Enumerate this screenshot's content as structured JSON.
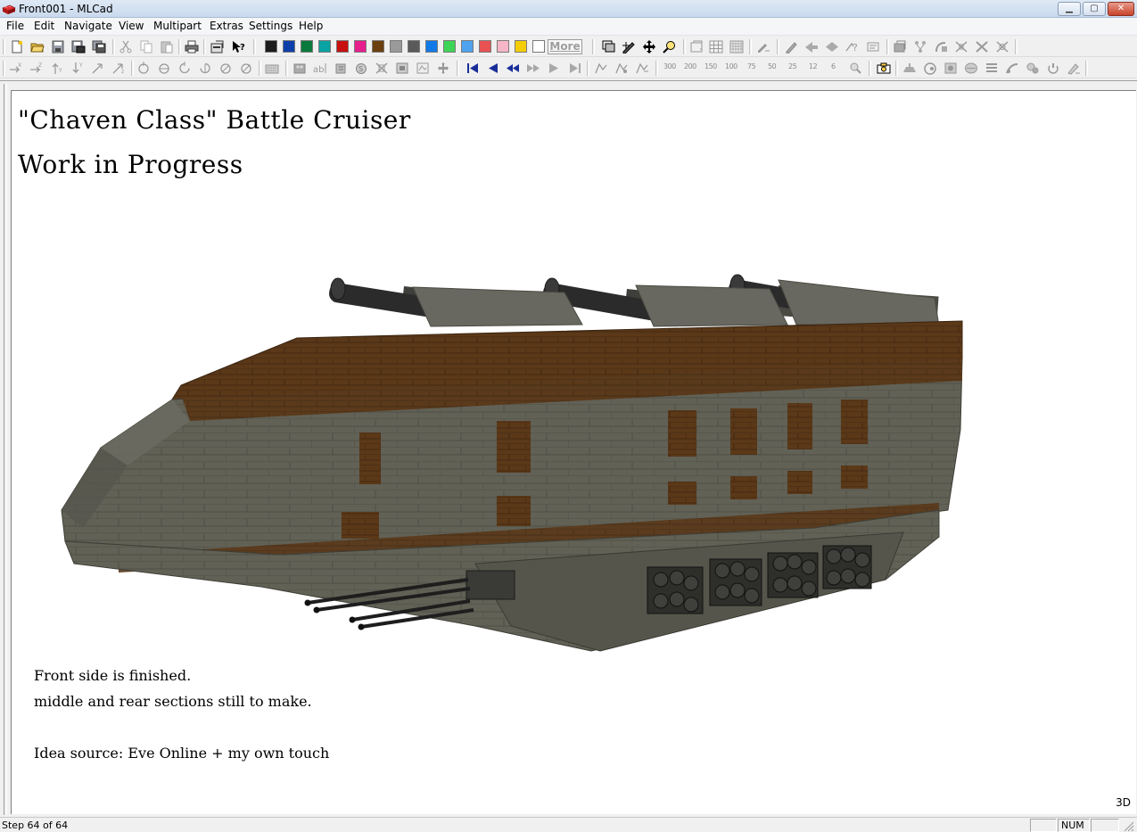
{
  "window": {
    "title": "Front001 - MLCad"
  },
  "menubar": {
    "items": [
      "File",
      "Edit",
      "Navigate",
      "View",
      "Multipart",
      "Extras",
      "Settings",
      "Help"
    ]
  },
  "toolbar": {
    "more_label": "More",
    "colors": [
      "#1b1b1b",
      "#0d3fa8",
      "#0a7a3c",
      "#0aa3a3",
      "#c81010",
      "#e61f8c",
      "#6b3f10",
      "#9a9a9a",
      "#5a5a5a",
      "#1179e8",
      "#3ed456",
      "#4fa3ee",
      "#e85252",
      "#f7b6c8",
      "#f5cd05",
      "#ffffff"
    ],
    "zoom_levels": [
      "300",
      "200",
      "150",
      "100",
      "75",
      "50",
      "25",
      "12",
      "6"
    ]
  },
  "canvas": {
    "title_line1": "\"Chaven Class\" Battle Cruiser",
    "title_line2": "Work in Progress",
    "note_line1": "Front side is finished.",
    "note_line2": "middle and rear sections still to make.",
    "note_line3": "Idea source: Eve Online + my own touch",
    "view_label": "3D"
  },
  "statusbar": {
    "step": "Step 64 of 64",
    "num_indicator": "NUM"
  },
  "colors": {
    "hull_gray": "#5f5f54",
    "hull_brown": "#5c3a16",
    "cannon": "#2b2b2b"
  }
}
